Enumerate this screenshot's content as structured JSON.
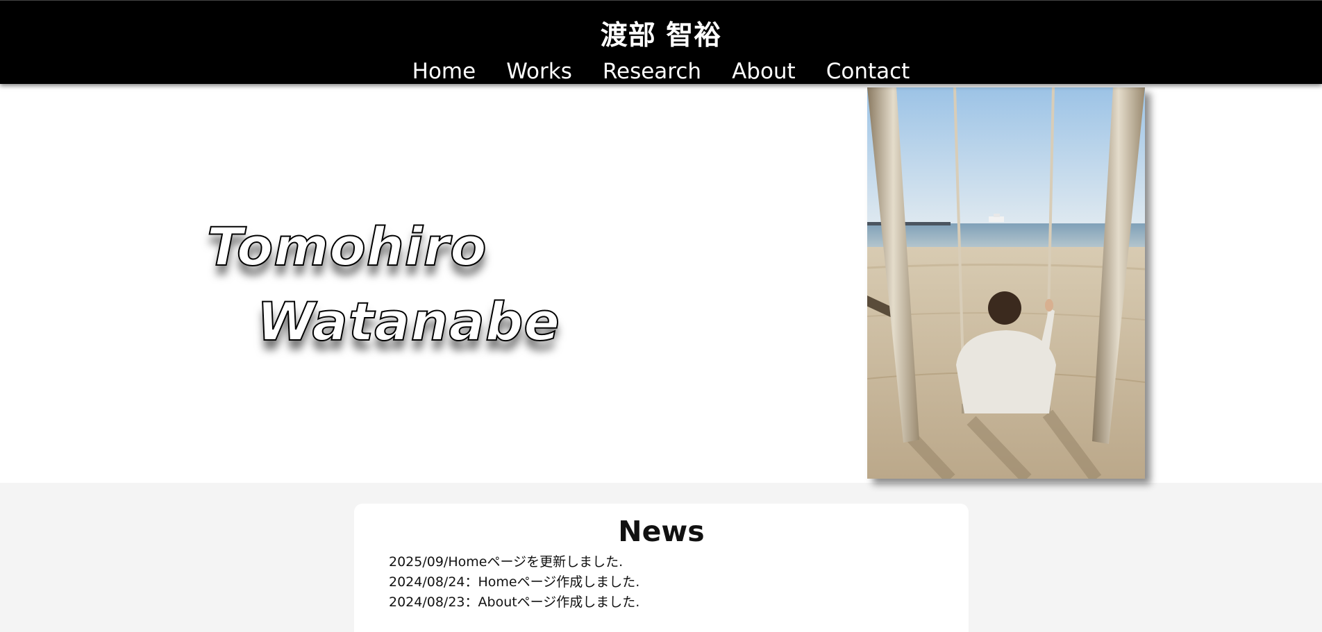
{
  "header": {
    "title": "渡部 智裕",
    "nav": [
      "Home",
      "Works",
      "Research",
      "About",
      "Contact"
    ]
  },
  "hero": {
    "name_first": "Tomohiro",
    "name_last": "Watanabe"
  },
  "news": {
    "title": "News",
    "items": [
      "2025/09/Homeページを更新しました.",
      "2024/08/24：Homeページ作成しました.",
      "2024/08/23：Aboutページ作成しました."
    ]
  },
  "colors": {
    "header_bg": "#000000",
    "page_bg": "#f4f4f4",
    "card_bg": "#ffffff"
  }
}
